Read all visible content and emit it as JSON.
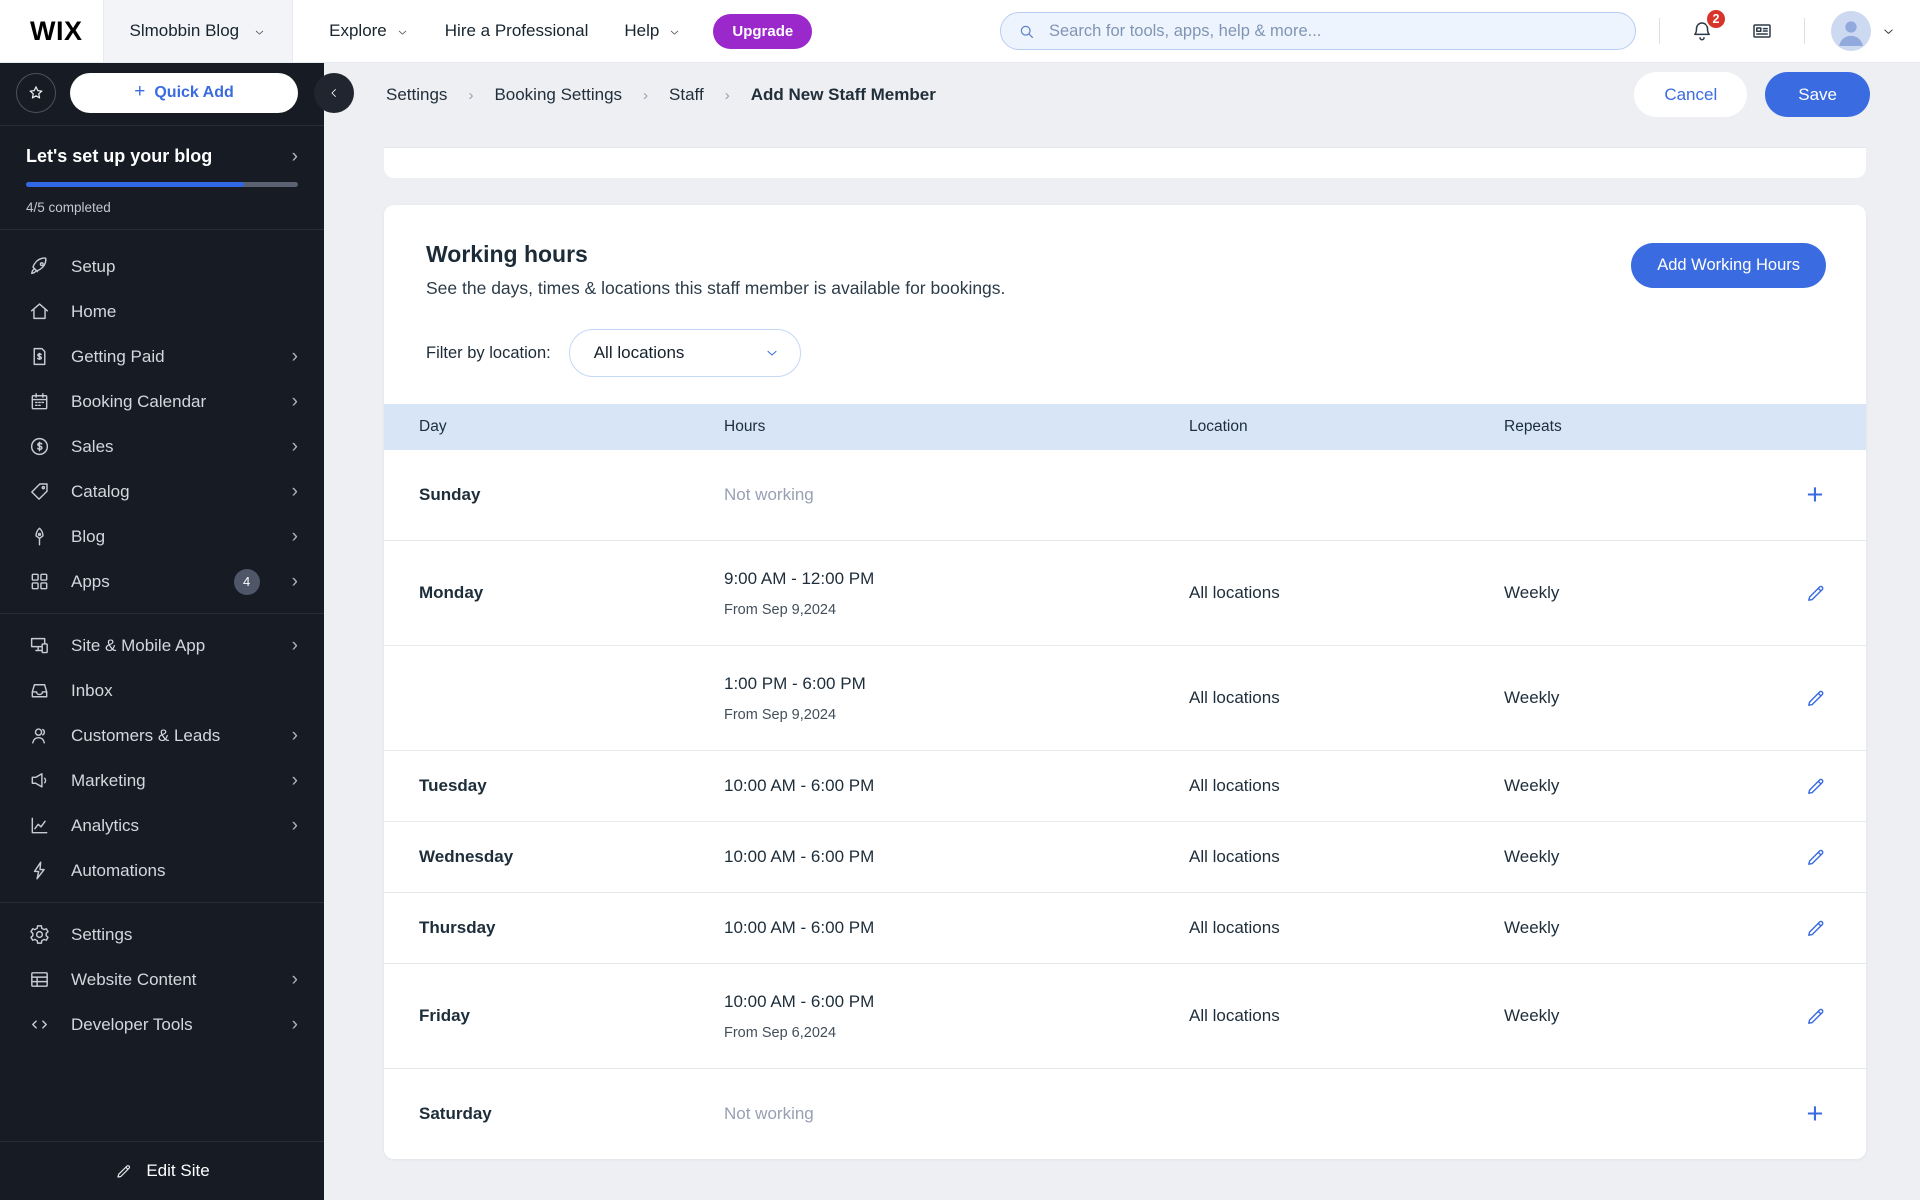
{
  "topbar": {
    "logo": "WIX",
    "site_menu": {
      "label": "Slmobbin Blog"
    },
    "nav": [
      {
        "label": "Explore",
        "chevron": true
      },
      {
        "label": "Hire a Professional",
        "chevron": false
      },
      {
        "label": "Help",
        "chevron": true
      }
    ],
    "upgrade_label": "Upgrade",
    "search": {
      "placeholder": "Search for tools, apps, help & more..."
    },
    "notifications_count": "2"
  },
  "sidebar": {
    "quick_add_label": "Quick Add",
    "setup_panel": {
      "title": "Let's set up your blog",
      "progress_percent": 80,
      "completed_text": "4/5 completed"
    },
    "groups": [
      {
        "items": [
          {
            "label": "Setup",
            "icon": "rocket-icon"
          },
          {
            "label": "Home",
            "icon": "home-icon"
          },
          {
            "label": "Getting Paid",
            "icon": "getting-paid-icon",
            "chevron": true
          },
          {
            "label": "Booking Calendar",
            "icon": "calendar-icon",
            "chevron": true
          },
          {
            "label": "Sales",
            "icon": "sales-icon",
            "chevron": true
          },
          {
            "label": "Catalog",
            "icon": "catalog-icon",
            "chevron": true
          },
          {
            "label": "Blog",
            "icon": "blog-icon",
            "chevron": true
          },
          {
            "label": "Apps",
            "icon": "apps-icon",
            "badge": "4",
            "chevron": true
          }
        ]
      },
      {
        "items": [
          {
            "label": "Site & Mobile App",
            "icon": "site-mobile-icon",
            "chevron": true
          },
          {
            "label": "Inbox",
            "icon": "inbox-icon"
          },
          {
            "label": "Customers & Leads",
            "icon": "customers-icon",
            "chevron": true
          },
          {
            "label": "Marketing",
            "icon": "marketing-icon",
            "chevron": true
          },
          {
            "label": "Analytics",
            "icon": "analytics-icon",
            "chevron": true
          },
          {
            "label": "Automations",
            "icon": "automations-icon"
          }
        ]
      },
      {
        "items": [
          {
            "label": "Settings",
            "icon": "settings-icon"
          },
          {
            "label": "Website Content",
            "icon": "website-content-icon",
            "chevron": true
          },
          {
            "label": "Developer Tools",
            "icon": "developer-tools-icon",
            "chevron": true
          }
        ]
      }
    ],
    "edit_site_label": "Edit Site"
  },
  "header": {
    "breadcrumbs": [
      "Settings",
      "Booking Settings",
      "Staff",
      "Add New Staff Member"
    ],
    "cancel_label": "Cancel",
    "save_label": "Save"
  },
  "working_hours": {
    "title": "Working hours",
    "subtitle": "See the days, times & locations this staff member is available for bookings.",
    "add_button_label": "Add Working Hours",
    "filter_label": "Filter by location:",
    "filter_value": "All locations",
    "table": {
      "columns": [
        "Day",
        "Hours",
        "Location",
        "Repeats"
      ],
      "rows": [
        {
          "day": "Sunday",
          "hours": "Not working",
          "not_working": true,
          "action": "add"
        },
        {
          "day": "Monday",
          "hours": "9:00 AM - 12:00 PM",
          "from": "From Sep 9,2024",
          "location": "All locations",
          "repeats": "Weekly",
          "action": "edit"
        },
        {
          "day": "",
          "hours": "1:00 PM - 6:00 PM",
          "from": "From Sep 9,2024",
          "location": "All locations",
          "repeats": "Weekly",
          "action": "edit"
        },
        {
          "day": "Tuesday",
          "hours": "10:00 AM - 6:00 PM",
          "location": "All locations",
          "repeats": "Weekly",
          "action": "edit"
        },
        {
          "day": "Wednesday",
          "hours": "10:00 AM - 6:00 PM",
          "location": "All locations",
          "repeats": "Weekly",
          "action": "edit"
        },
        {
          "day": "Thursday",
          "hours": "10:00 AM - 6:00 PM",
          "location": "All locations",
          "repeats": "Weekly",
          "action": "edit"
        },
        {
          "day": "Friday",
          "hours": "10:00 AM - 6:00 PM",
          "from": "From Sep 6,2024",
          "location": "All locations",
          "repeats": "Weekly",
          "action": "edit"
        },
        {
          "day": "Saturday",
          "hours": "Not working",
          "not_working": true,
          "action": "add"
        }
      ]
    }
  },
  "colors": {
    "accent_blue": "#3a6be0",
    "upgrade_purple": "#9b28ca",
    "badge_red": "#d8342b",
    "sidebar_bg": "#161b24",
    "table_header_bg": "#d8e5f7"
  }
}
